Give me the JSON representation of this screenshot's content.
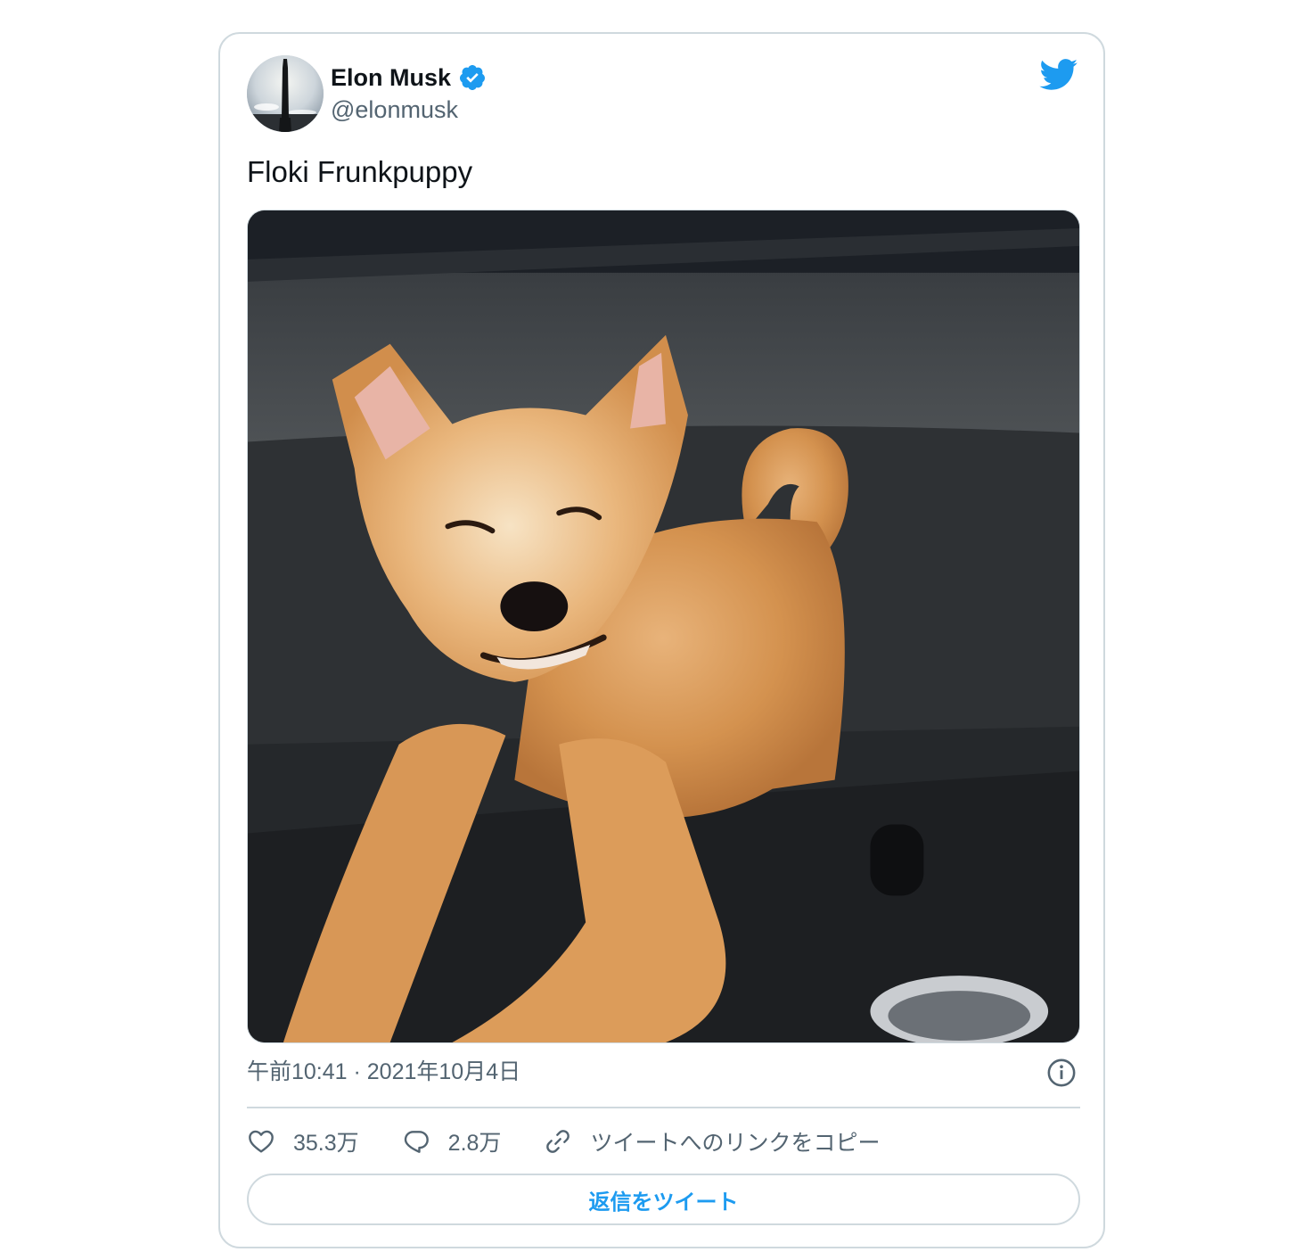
{
  "author": {
    "name": "Elon Musk",
    "handle": "@elonmusk",
    "verified": true
  },
  "tweet": {
    "text": "Floki Frunkpuppy",
    "timestamp": "午前10:41 · 2021年10月4日"
  },
  "actions": {
    "likes": "35.3万",
    "replies": "2.8万",
    "copy_link": "ツイートへのリンクをコピー"
  },
  "reply_button": "返信をツイート",
  "icons": [
    "verified-badge-icon",
    "twitter-bird-icon",
    "info-icon",
    "heart-icon",
    "reply-bubble-icon",
    "link-icon"
  ],
  "colors": {
    "accent": "#1d9bf0",
    "text": "#0f1419",
    "muted": "#536471",
    "border": "#cfd9de"
  }
}
